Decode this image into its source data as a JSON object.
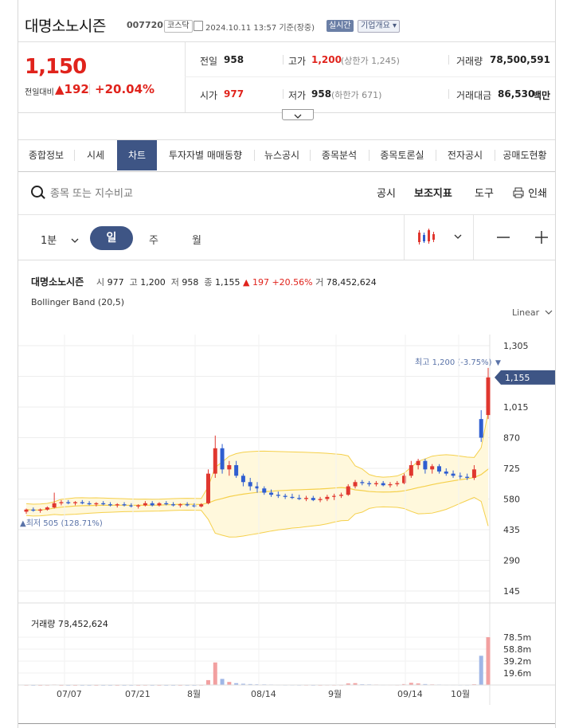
{
  "header": {
    "name": "대명소노시즌",
    "code": "007720",
    "market": "코스닥",
    "timestamp": "2024.10.11 13:57 기준(장중)",
    "realtime": "실시간",
    "company_info": "기업개요"
  },
  "price": {
    "current": "1,150",
    "change_label": "전일대비",
    "change": "192",
    "change_pct": "+20.04%",
    "prev_close_label": "전일",
    "prev_close": "958",
    "high_label": "고가",
    "high": "1,200",
    "upper_limit": "(상한가 1,245)",
    "volume_label": "거래량",
    "volume": "78,500,591",
    "open_label": "시가",
    "open": "977",
    "low_label": "저가",
    "low": "958",
    "lower_limit": "(하한가 671)",
    "amount_label": "거래대금",
    "amount": "86,530",
    "amount_unit": "백만"
  },
  "tabs": [
    "종합정보",
    "시세",
    "차트",
    "투자자별 매매동향",
    "뉴스공시",
    "종목분석",
    "종목토론실",
    "전자공시",
    "공매도현황"
  ],
  "toolbar": {
    "search_placeholder": "종목 또는 지수비교",
    "menu": [
      "공시",
      "보조지표",
      "도구",
      "인쇄"
    ]
  },
  "periods": {
    "minute": "1분",
    "day": "일",
    "week": "주",
    "month": "월"
  },
  "chart_header": {
    "name": "대명소노시즌",
    "o_lbl": "시",
    "o": "977",
    "h_lbl": "고",
    "h": "1,200",
    "l_lbl": "저",
    "l": "958",
    "c_lbl": "종",
    "c": "1,155",
    "chg": "197",
    "pct": "+20.56%",
    "v_lbl": "거",
    "v": "78,452,624",
    "indicator": "Bollinger Band (20,5)",
    "scale": "Linear"
  },
  "chart_data": {
    "type": "candlestick",
    "y_ticks": [
      "1,305",
      "1,160",
      "1,015",
      "870",
      "725",
      "580",
      "435",
      "290",
      "145"
    ],
    "y_range": [
      145,
      1305
    ],
    "x_ticks": [
      "07/07",
      "07/21",
      "8월",
      "08/14",
      "9월",
      "09/14",
      "10월"
    ],
    "max_label": "최고 1,200 (-3.75%)",
    "min_label": "최저 505 (128.71%)",
    "current_label": "1,155",
    "candles": [
      [
        520,
        535,
        510,
        530
      ],
      [
        530,
        540,
        520,
        525
      ],
      [
        525,
        535,
        515,
        530
      ],
      [
        530,
        545,
        525,
        540
      ],
      [
        540,
        610,
        535,
        560
      ],
      [
        560,
        575,
        550,
        565
      ],
      [
        565,
        575,
        555,
        560
      ],
      [
        560,
        570,
        550,
        565
      ],
      [
        565,
        575,
        555,
        560
      ],
      [
        560,
        570,
        550,
        555
      ],
      [
        555,
        565,
        545,
        560
      ],
      [
        560,
        570,
        550,
        555
      ],
      [
        555,
        565,
        545,
        550
      ],
      [
        550,
        560,
        540,
        555
      ],
      [
        555,
        565,
        545,
        550
      ],
      [
        550,
        560,
        540,
        545
      ],
      [
        545,
        555,
        535,
        550
      ],
      [
        550,
        570,
        545,
        560
      ],
      [
        560,
        570,
        545,
        550
      ],
      [
        550,
        565,
        545,
        560
      ],
      [
        560,
        570,
        550,
        555
      ],
      [
        555,
        565,
        545,
        550
      ],
      [
        550,
        560,
        540,
        555
      ],
      [
        555,
        565,
        545,
        550
      ],
      [
        550,
        560,
        540,
        545
      ],
      [
        545,
        560,
        540,
        555
      ],
      [
        560,
        720,
        555,
        700
      ],
      [
        700,
        880,
        680,
        820
      ],
      [
        820,
        840,
        700,
        720
      ],
      [
        720,
        760,
        690,
        740
      ],
      [
        740,
        760,
        680,
        690
      ],
      [
        690,
        700,
        640,
        660
      ],
      [
        660,
        680,
        620,
        640
      ],
      [
        640,
        660,
        610,
        630
      ],
      [
        630,
        640,
        600,
        610
      ],
      [
        610,
        625,
        590,
        600
      ],
      [
        600,
        615,
        585,
        595
      ],
      [
        595,
        605,
        580,
        590
      ],
      [
        590,
        605,
        580,
        585
      ],
      [
        585,
        600,
        575,
        580
      ],
      [
        580,
        595,
        570,
        585
      ],
      [
        585,
        595,
        570,
        575
      ],
      [
        575,
        590,
        565,
        580
      ],
      [
        580,
        600,
        570,
        590
      ],
      [
        590,
        605,
        575,
        595
      ],
      [
        595,
        610,
        585,
        600
      ],
      [
        600,
        650,
        595,
        640
      ],
      [
        640,
        670,
        630,
        660
      ],
      [
        660,
        670,
        645,
        655
      ],
      [
        655,
        665,
        640,
        650
      ],
      [
        650,
        665,
        640,
        655
      ],
      [
        655,
        665,
        640,
        645
      ],
      [
        645,
        660,
        635,
        650
      ],
      [
        650,
        665,
        640,
        655
      ],
      [
        655,
        700,
        650,
        690
      ],
      [
        690,
        760,
        680,
        740
      ],
      [
        740,
        770,
        720,
        760
      ],
      [
        760,
        770,
        700,
        720
      ],
      [
        720,
        745,
        700,
        735
      ],
      [
        735,
        745,
        700,
        710
      ],
      [
        710,
        725,
        690,
        700
      ],
      [
        700,
        715,
        680,
        690
      ],
      [
        690,
        705,
        675,
        685
      ],
      [
        685,
        700,
        670,
        680
      ],
      [
        680,
        740,
        670,
        720
      ],
      [
        958,
        1000,
        850,
        870
      ],
      [
        977,
        1200,
        958,
        1155
      ]
    ],
    "volumes": [
      0.3,
      0.2,
      0.2,
      0.3,
      0.8,
      0.2,
      0.2,
      0.2,
      0.2,
      0.2,
      0.2,
      0.2,
      0.2,
      0.2,
      0.2,
      0.2,
      0.2,
      0.3,
      0.2,
      0.2,
      0.2,
      0.2,
      0.2,
      0.2,
      0.2,
      0.3,
      8.0,
      37.0,
      10.0,
      5.0,
      3.0,
      2.0,
      1.5,
      1.2,
      1.0,
      0.8,
      0.6,
      0.5,
      0.5,
      0.4,
      0.4,
      0.3,
      0.3,
      0.5,
      0.4,
      0.4,
      2.5,
      3.0,
      1.2,
      1.0,
      0.8,
      0.6,
      0.6,
      0.5,
      1.5,
      3.5,
      2.5,
      1.5,
      1.0,
      0.8,
      0.6,
      0.6,
      0.5,
      0.5,
      1.2,
      48.0,
      78.5
    ],
    "volume_label": "거래량 78,452,624",
    "volume_ticks": [
      "78.5m",
      "58.8m",
      "39.2m",
      "19.6m"
    ],
    "colors": {
      "up": "#e0372f",
      "down": "#2f5ed0",
      "band": "#f5d04b",
      "band_fill": "#fff8dc"
    }
  }
}
